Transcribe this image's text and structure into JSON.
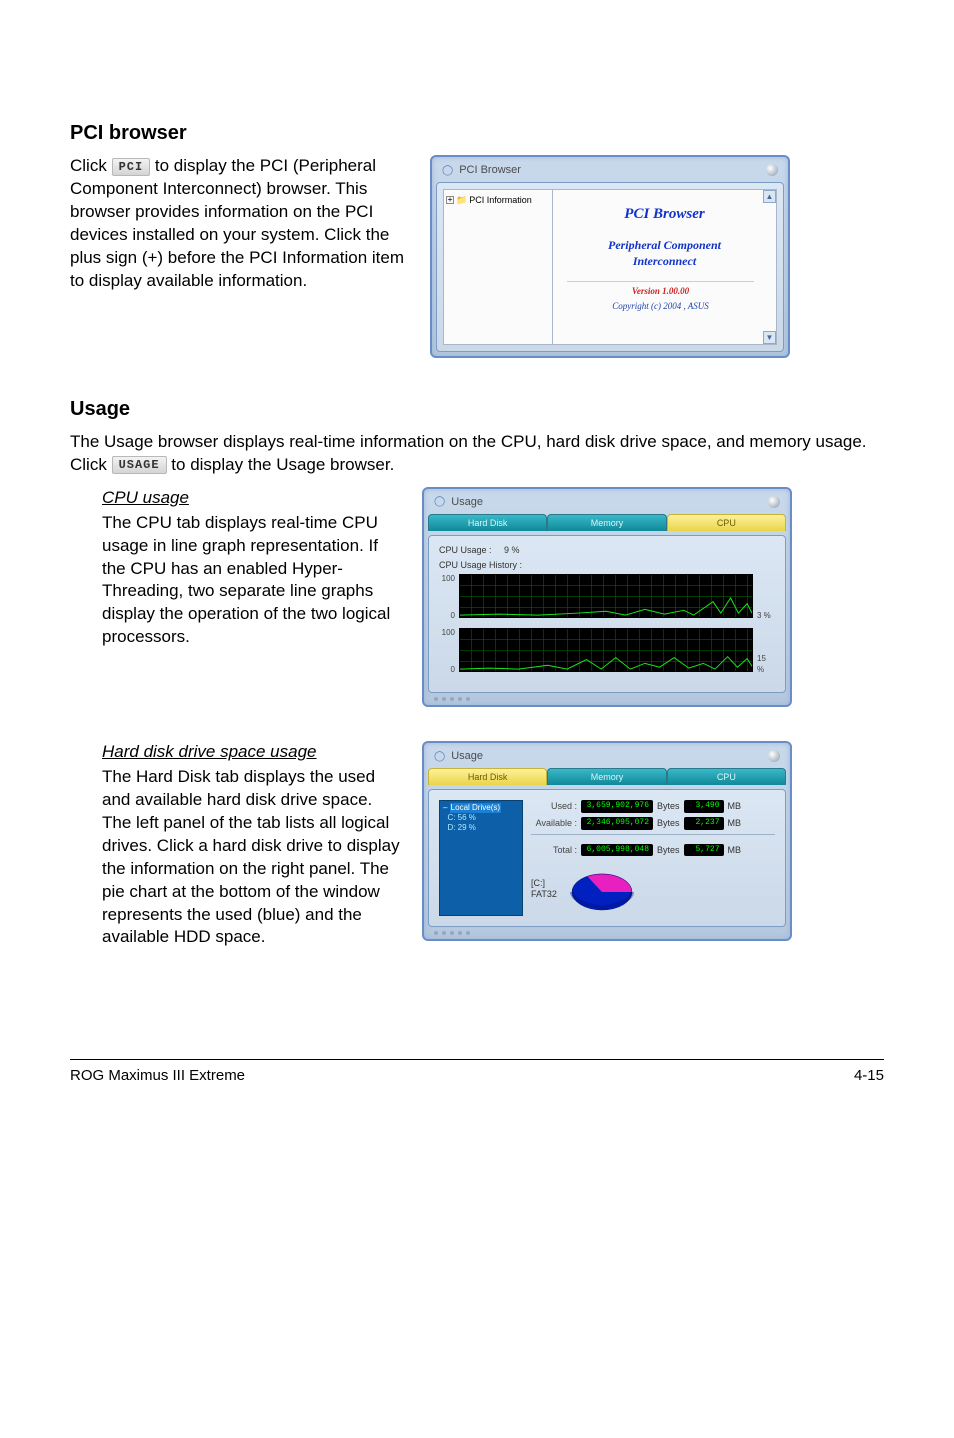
{
  "pci": {
    "heading": "PCI browser",
    "para_pre": "Click ",
    "btn_label": "PCI",
    "para_post": " to display the PCI (Peripheral Component Interconnect) browser. This browser provides information on the PCI devices installed on your system. Click the plus sign (+) before the PCI Information item to display available information.",
    "window": {
      "title": "PCI Browser",
      "tree_plus": "+",
      "tree_item": "PCI Information",
      "main_title1": "PCI  Browser",
      "main_title2": "Peripheral Component\nInterconnect",
      "version": "Version 1.00.00",
      "copyright": "Copyright (c) 2004 ,  ASUS",
      "scroll_up": "▲",
      "scroll_dn": "▼"
    }
  },
  "usage": {
    "heading": "Usage",
    "intro_pre": "The Usage browser displays real-time information on the CPU, hard disk drive space, and memory usage. Click ",
    "btn_label": "USAGE",
    "intro_post": " to display the Usage browser.",
    "cpu": {
      "heading": "CPU usage",
      "para": "The CPU tab displays real-time CPU usage in line graph representation. If the CPU has an enabled Hyper-Threading, two separate line graphs display the operation of the two logical processors.",
      "window": {
        "title": "Usage",
        "tabs": {
          "hdd": "Hard Disk",
          "mem": "Memory",
          "cpu": "CPU"
        },
        "usage_label": "CPU Usage :",
        "usage_val": "9  %",
        "history_label": "CPU Usage History :",
        "axis_top": "100",
        "axis_bottom": "0",
        "pct1": "3 %",
        "pct2": "15 %"
      }
    },
    "hdd": {
      "heading": "Hard disk drive space usage",
      "para": "The Hard Disk tab displays the used and available hard disk drive space. The left panel of the tab lists all logical drives. Click a hard disk drive to display the information on the right panel. The pie chart at the bottom of the window represents the used (blue) and the available HDD space.",
      "window": {
        "title": "Usage",
        "tabs": {
          "hdd": "Hard Disk",
          "mem": "Memory",
          "cpu": "CPU"
        },
        "tree_root": "Local Drive(s)",
        "tree_c": "C: 56 %",
        "tree_d": "D: 29 %",
        "rows": {
          "used_k": "Used :",
          "used_bytes": "3,659,902,976",
          "used_unit": "Bytes",
          "used_mb": "3,490",
          "mb": "MB",
          "avail_k": "Available :",
          "avail_bytes": "2,346,095,072",
          "avail_unit": "Bytes",
          "avail_mb": "2,237",
          "total_k": "Total :",
          "total_bytes": "6,005,998,048",
          "total_unit": "Bytes",
          "total_mb": "5,727"
        },
        "pie_label1": "[C:]",
        "pie_label2": "FAT32"
      }
    }
  },
  "footer": {
    "left": "ROG Maximus III Extreme",
    "right": "4-15"
  }
}
